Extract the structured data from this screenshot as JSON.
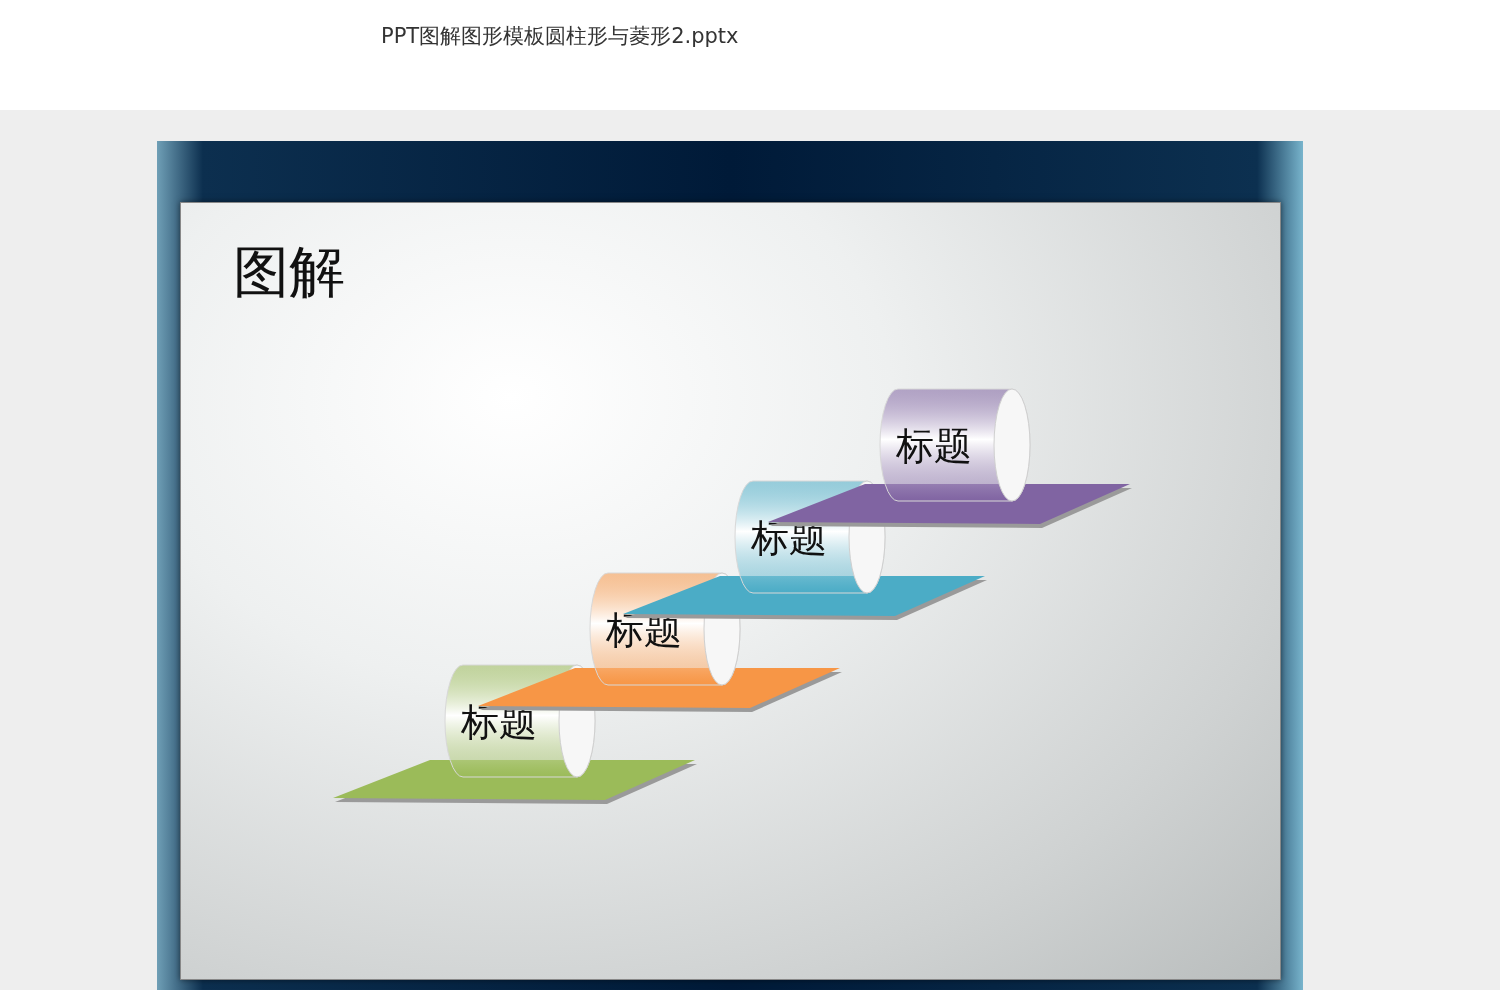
{
  "document": {
    "title": "PPT图解图形模板圆柱形与菱形2.pptx"
  },
  "slide": {
    "title": "图解",
    "steps": [
      {
        "label": "标题",
        "color": "#9bbb59"
      },
      {
        "label": "标题",
        "color": "#f79646"
      },
      {
        "label": "标题",
        "color": "#4bacc6"
      },
      {
        "label": "标题",
        "color": "#8064a2"
      }
    ]
  }
}
